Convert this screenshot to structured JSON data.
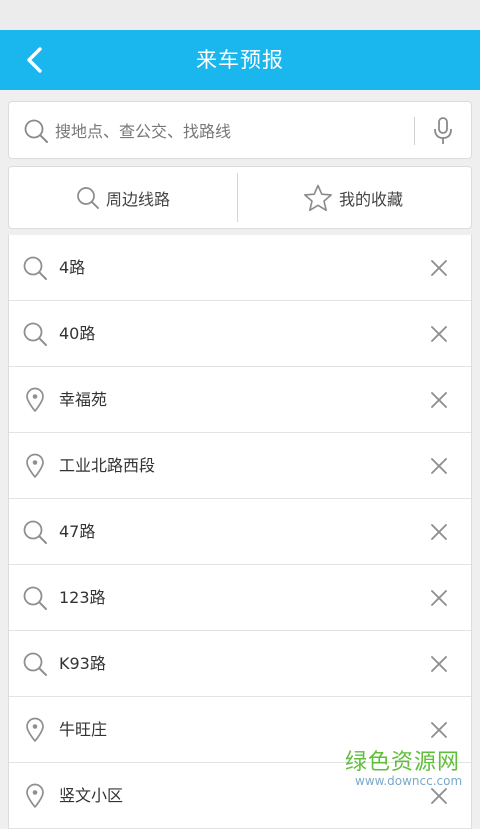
{
  "header": {
    "title": "来车预报"
  },
  "search": {
    "placeholder": "搜地点、查公交、找路线"
  },
  "tabs": [
    {
      "label": "周边线路",
      "icon": "search-icon"
    },
    {
      "label": "我的收藏",
      "icon": "star-icon"
    }
  ],
  "history": [
    {
      "label": "4路",
      "icon": "search"
    },
    {
      "label": "40路",
      "icon": "search"
    },
    {
      "label": "幸福苑",
      "icon": "location"
    },
    {
      "label": "工业北路西段",
      "icon": "location"
    },
    {
      "label": "47路",
      "icon": "search"
    },
    {
      "label": "123路",
      "icon": "search"
    },
    {
      "label": "K93路",
      "icon": "search"
    },
    {
      "label": "牛旺庄",
      "icon": "location"
    },
    {
      "label": "竖文小区",
      "icon": "location"
    }
  ],
  "watermark": {
    "main": "绿色资源网",
    "sub": "www.downcc.com"
  },
  "colors": {
    "header": "#1ab6ee",
    "background": "#efefef",
    "icon_gray": "#999999",
    "watermark": "#5fbf3a"
  }
}
